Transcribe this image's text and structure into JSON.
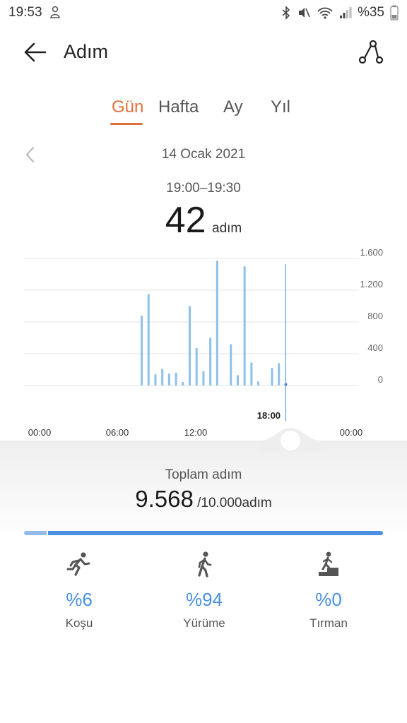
{
  "status_bar": {
    "time": "19:53",
    "battery": "%35"
  },
  "header": {
    "title": "Adım"
  },
  "tabs": [
    {
      "label": "Gün",
      "active": true
    },
    {
      "label": "Hafta",
      "active": false
    },
    {
      "label": "Ay",
      "active": false
    },
    {
      "label": "Yıl",
      "active": false
    }
  ],
  "date": "14 Ocak 2021",
  "selection": {
    "time_range": "19:00–19:30",
    "value": "42",
    "unit": "adım"
  },
  "chart_data": {
    "type": "bar",
    "y_ticks": [
      "1.600",
      "1.200",
      "800",
      "400",
      "0"
    ],
    "ylim": [
      0,
      1600
    ],
    "x_ticks": [
      "00:00",
      "06:00",
      "12:00",
      "18:00",
      "00:00"
    ],
    "selected_label": "18:00",
    "selected_value": 42,
    "bar_color": "#8ec0ee",
    "selected_color": "#2f80d8",
    "bars": [
      {
        "t": "08:30",
        "value": 880
      },
      {
        "t": "09:00",
        "value": 1150
      },
      {
        "t": "09:30",
        "value": 140
      },
      {
        "t": "10:00",
        "value": 210
      },
      {
        "t": "10:30",
        "value": 150
      },
      {
        "t": "11:00",
        "value": 160
      },
      {
        "t": "11:30",
        "value": 45
      },
      {
        "t": "12:00",
        "value": 1000
      },
      {
        "t": "12:30",
        "value": 470
      },
      {
        "t": "13:00",
        "value": 180
      },
      {
        "t": "13:30",
        "value": 600
      },
      {
        "t": "14:00",
        "value": 1570
      },
      {
        "t": "15:00",
        "value": 520
      },
      {
        "t": "15:30",
        "value": 130
      },
      {
        "t": "16:00",
        "value": 1500
      },
      {
        "t": "16:30",
        "value": 290
      },
      {
        "t": "17:00",
        "value": 50
      },
      {
        "t": "18:00",
        "value": 220
      },
      {
        "t": "18:30",
        "value": 280
      },
      {
        "t": "19:00",
        "value": 42
      }
    ]
  },
  "summary": {
    "label": "Toplam adım",
    "total": "9.568",
    "goal": " /10.000adım",
    "progress_fraction": 0.9568
  },
  "activities": [
    {
      "icon": "running-icon",
      "percent": "%6",
      "name": "Koşu"
    },
    {
      "icon": "walking-icon",
      "percent": "%94",
      "name": "Yürüme"
    },
    {
      "icon": "climbing-icon",
      "percent": "%0",
      "name": "Tırman"
    }
  ]
}
